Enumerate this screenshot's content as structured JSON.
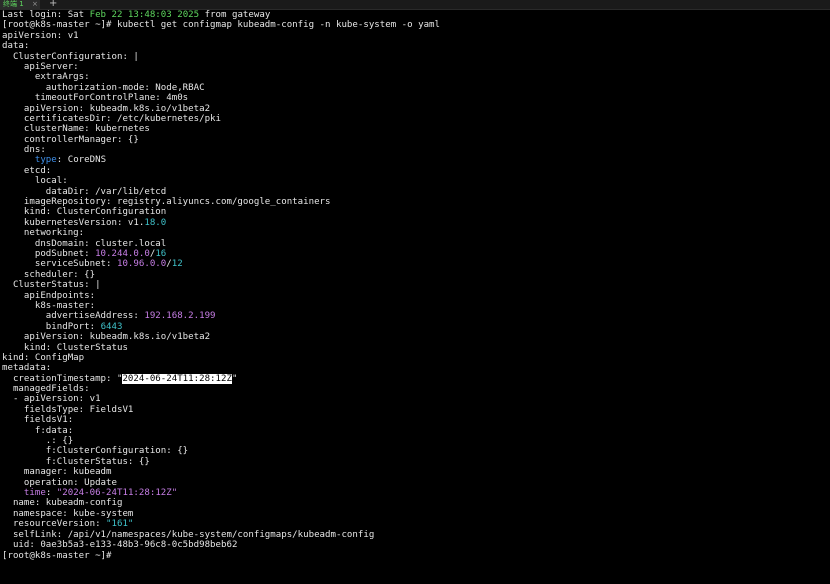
{
  "tab": {
    "title": "终端 1",
    "close_icon": "×",
    "add_icon": "+"
  },
  "colors": {
    "background": "#000000",
    "text": "#e6e6e6",
    "green": "#5fd75f",
    "blue": "#3f8fe8",
    "cyan": "#3fc1c9",
    "magenta": "#c77ee6"
  },
  "terminal": {
    "lines": [
      [
        {
          "t": "Last login: Sat "
        },
        {
          "t": "Feb 22 13:48:03",
          "c": "green"
        },
        {
          "t": " "
        },
        {
          "t": "2025",
          "c": "green"
        },
        {
          "t": " from gateway"
        }
      ],
      [
        {
          "t": "[root@k8s-master ~]# kubectl get configmap kubeadm-config -n kube-system -o yaml"
        }
      ],
      [
        {
          "t": "apiVersion: v1"
        }
      ],
      [
        {
          "t": "data:"
        }
      ],
      [
        {
          "t": "  ClusterConfiguration: |"
        }
      ],
      [
        {
          "t": "    apiServer:"
        }
      ],
      [
        {
          "t": "      extraArgs:"
        }
      ],
      [
        {
          "t": "        authorization-mode: Node,RBAC"
        }
      ],
      [
        {
          "t": "      timeoutForControlPlane: 4m0s"
        }
      ],
      [
        {
          "t": "    apiVersion: kubeadm.k8s.io/v1beta2"
        }
      ],
      [
        {
          "t": "    certificatesDir: /etc/kubernetes/pki"
        }
      ],
      [
        {
          "t": "    clusterName: kubernetes"
        }
      ],
      [
        {
          "t": "    controllerManager: {}"
        }
      ],
      [
        {
          "t": "    dns:"
        }
      ],
      [
        {
          "t": "      "
        },
        {
          "t": "type",
          "c": "blue"
        },
        {
          "t": ": CoreDNS"
        }
      ],
      [
        {
          "t": "    etcd:"
        }
      ],
      [
        {
          "t": "      local:"
        }
      ],
      [
        {
          "t": "        dataDir: /var/lib/etcd"
        }
      ],
      [
        {
          "t": "    imageRepository: registry.aliyuncs.com/google_containers"
        }
      ],
      [
        {
          "t": "    kind: ClusterConfiguration"
        }
      ],
      [
        {
          "t": "    kubernetesVersion: v1."
        },
        {
          "t": "18.0",
          "c": "cyan"
        }
      ],
      [
        {
          "t": "    networking:"
        }
      ],
      [
        {
          "t": "      dnsDomain: cluster.local"
        }
      ],
      [
        {
          "t": "      podSubnet: "
        },
        {
          "t": "10.244.0.0",
          "c": "magenta"
        },
        {
          "t": "/"
        },
        {
          "t": "16",
          "c": "cyan"
        }
      ],
      [
        {
          "t": "      serviceSubnet: "
        },
        {
          "t": "10.96.0.0",
          "c": "magenta"
        },
        {
          "t": "/"
        },
        {
          "t": "12",
          "c": "cyan"
        }
      ],
      [
        {
          "t": "    scheduler: {}"
        }
      ],
      [
        {
          "t": "  ClusterStatus: |"
        }
      ],
      [
        {
          "t": "    apiEndpoints:"
        }
      ],
      [
        {
          "t": "      k8s-master:"
        }
      ],
      [
        {
          "t": "        advertiseAddress: "
        },
        {
          "t": "192.168.2.199",
          "c": "magenta"
        }
      ],
      [
        {
          "t": "        bindPort: "
        },
        {
          "t": "6443",
          "c": "cyan"
        }
      ],
      [
        {
          "t": "    apiVersion: kubeadm.k8s.io/v1beta2"
        }
      ],
      [
        {
          "t": "    kind: ClusterStatus"
        }
      ],
      [
        {
          "t": "kind: ConfigMap"
        }
      ],
      [
        {
          "t": "metadata:"
        }
      ],
      [
        {
          "t": "  creationTimestamp: \""
        },
        {
          "t": "2024-06-24T11:28:12Z",
          "c": "highlight"
        },
        {
          "t": "\""
        }
      ],
      [
        {
          "t": "  managedFields:"
        }
      ],
      [
        {
          "t": "  - apiVersion: v1"
        }
      ],
      [
        {
          "t": "    fieldsType: FieldsV1"
        }
      ],
      [
        {
          "t": "    fieldsV1:"
        }
      ],
      [
        {
          "t": "      f:data:"
        }
      ],
      [
        {
          "t": "        .: {}"
        }
      ],
      [
        {
          "t": "        f:ClusterConfiguration: {}"
        }
      ],
      [
        {
          "t": "        f:ClusterStatus: {}"
        }
      ],
      [
        {
          "t": "    manager: kubeadm"
        }
      ],
      [
        {
          "t": "    operation: Update"
        }
      ],
      [
        {
          "t": "    "
        },
        {
          "t": "time",
          "c": "magenta"
        },
        {
          "t": ": "
        },
        {
          "t": "\"2024-06-24T11:28:12Z\"",
          "c": "magenta"
        }
      ],
      [
        {
          "t": "  name: kubeadm-config"
        }
      ],
      [
        {
          "t": "  namespace: kube-system"
        }
      ],
      [
        {
          "t": "  resourceVersion: "
        },
        {
          "t": "\"161\"",
          "c": "cyan"
        }
      ],
      [
        {
          "t": "  selfLink: /api/v1/namespaces/kube-system/configmaps/kubeadm-config"
        }
      ],
      [
        {
          "t": "  uid: 0ae3b5a3-e133-48b3-96c8-0c5bd98beb62"
        }
      ],
      [
        {
          "t": "[root@k8s-master ~]# "
        }
      ]
    ]
  }
}
